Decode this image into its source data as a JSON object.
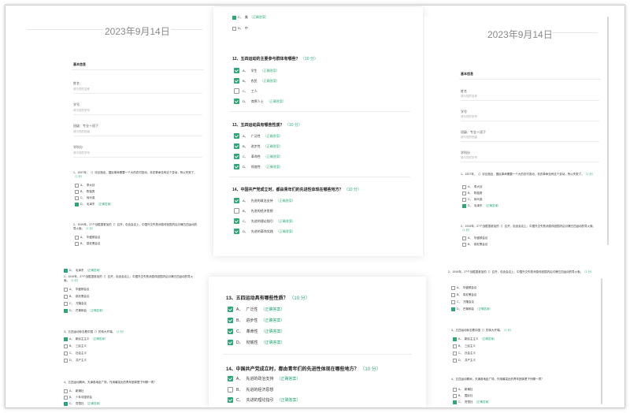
{
  "dates": {
    "left": "2023年9月14日",
    "right": "2023年9月14日"
  },
  "basic_info": {
    "title": "基本信息",
    "fields": [
      {
        "label": "姓名",
        "placeholder": "请与您的名称"
      },
      {
        "label": "学号",
        "placeholder": "请与您的学号"
      },
      {
        "label": "班级：专业＋班下",
        "placeholder": "请与您的班级"
      },
      {
        "label": "学科分",
        "placeholder": "请与您的学号"
      }
    ]
  },
  "small_questions": {
    "q1": {
      "text": "1、1927年，（）评论指出，国民革命需要一个大的农村变动，非农革命没有这个变动，所以失败了。",
      "points": "（1 分）"
    },
    "q1_options": [
      {
        "letter": "A、",
        "text": "李大钊",
        "checked": false,
        "answer": ""
      },
      {
        "letter": "B、",
        "text": "陈独秀",
        "checked": false,
        "answer": ""
      },
      {
        "letter": "C、",
        "text": "恽代英",
        "checked": false,
        "answer": ""
      },
      {
        "letter": "D、",
        "text": "毛泽东",
        "checked": true,
        "answer": "（正确答案）"
      }
    ],
    "q2": {
      "text": "2、1919年，27个战胜国参加的（）召开，包含会议上，中国外交失败消息传回国内后引爆五四运动的导火索。",
      "points": "（1 分）"
    },
    "q2_options": [
      {
        "letter": "A、",
        "text": "华盛顿会议",
        "checked": false,
        "answer": ""
      },
      {
        "letter": "B、",
        "text": "慕尼黑会议",
        "checked": false,
        "answer": ""
      },
      {
        "letter": "C、",
        "text": "万隆会议",
        "checked": false,
        "answer": ""
      },
      {
        "letter": "D、",
        "text": "巴黎和会",
        "checked": true,
        "answer": "（正确答案）"
      }
    ],
    "q3": {
      "text": "3、五四运动标志着中国（）的伟大开端。",
      "points": "（1 分）"
    },
    "q3_options": [
      {
        "letter": "A、",
        "text": "新民主主义",
        "checked": true,
        "answer": "（正确答案）"
      },
      {
        "letter": "B、",
        "text": "三民主义",
        "checked": false,
        "answer": ""
      },
      {
        "letter": "C、",
        "text": "社会主义",
        "checked": false,
        "answer": ""
      },
      {
        "letter": "D、",
        "text": "共产主义",
        "checked": false,
        "answer": ""
      }
    ],
    "q4": {
      "text": "4、五四运动期间，天津各地赴广场，作用最突出的青年团体是下列哪一项？",
      "points": "（1 分）"
    },
    "q4_options": [
      {
        "letter": "A、",
        "text": "新潮社",
        "checked": false,
        "answer": ""
      },
      {
        "letter": "B、",
        "text": "少年中国学会",
        "checked": false,
        "answer": ""
      },
      {
        "letter": "C、",
        "text": "觉悟社",
        "checked": true,
        "answer": "（正确答案）"
      }
    ],
    "q4_options_short": [
      {
        "letter": "A、",
        "text": "新潮社",
        "checked": false,
        "answer": ""
      },
      {
        "letter": "B、",
        "text": "国民社",
        "checked": false,
        "answer": ""
      },
      {
        "letter": "C、",
        "text": "觉悟社",
        "checked": true,
        "answer": "（正确答案）"
      }
    ]
  },
  "center_top": {
    "prev_options": [
      {
        "letter": "C、",
        "text": "美",
        "answer": "（正确答案）"
      },
      {
        "letter": "D、",
        "text": "中",
        "answer": ""
      }
    ],
    "q12": {
      "text": "12、五四运动的主要参与群体有哪些？",
      "points": "（10 分）"
    },
    "q12_options": [
      {
        "letter": "A、",
        "text": "学生",
        "checked": true,
        "answer": "（正确答案）"
      },
      {
        "letter": "B、",
        "text": "农民",
        "checked": true,
        "answer": "（正确答案）"
      },
      {
        "letter": "C、",
        "text": "工人",
        "checked": false,
        "answer": ""
      },
      {
        "letter": "D、",
        "text": "商界人士",
        "checked": true,
        "answer": "（正确答案）"
      }
    ],
    "q13": {
      "text": "13、五四运动具有哪些性质？",
      "points": "（10 分）"
    },
    "q13_options": [
      {
        "letter": "A、",
        "text": "广泛性",
        "checked": true,
        "answer": "（正确答案）"
      },
      {
        "letter": "B、",
        "text": "进步性",
        "checked": true,
        "answer": "（正确答案）"
      },
      {
        "letter": "C、",
        "text": "革命性",
        "checked": true,
        "answer": "（正确答案）"
      },
      {
        "letter": "D、",
        "text": "彻底性",
        "checked": true,
        "answer": "（正确答案）"
      }
    ],
    "q14": {
      "text": "14、中国共产党成立时，都由青年们的先进性体现在哪些地方？",
      "points": "（10 分）"
    },
    "q14_options": [
      {
        "letter": "A、",
        "text": "先进的政治支持",
        "checked": true,
        "answer": "（正确答案）"
      },
      {
        "letter": "B、",
        "text": "先进的经济思想",
        "checked": false,
        "answer": ""
      },
      {
        "letter": "C、",
        "text": "先进的理论指引",
        "checked": true,
        "answer": "（正确答案）"
      },
      {
        "letter": "D、",
        "text": "先进的革命实践",
        "checked": true,
        "answer": "（正确答案）"
      }
    ],
    "q14_options_short": [
      {
        "letter": "A、",
        "text": "先进的政治支持",
        "checked": true,
        "answer": "（正确答案）"
      },
      {
        "letter": "B、",
        "text": "先进的经济思想",
        "checked": false,
        "answer": ""
      },
      {
        "letter": "C、",
        "text": "先进的理论指引",
        "checked": true,
        "answer": "（正确答案）"
      }
    ]
  }
}
